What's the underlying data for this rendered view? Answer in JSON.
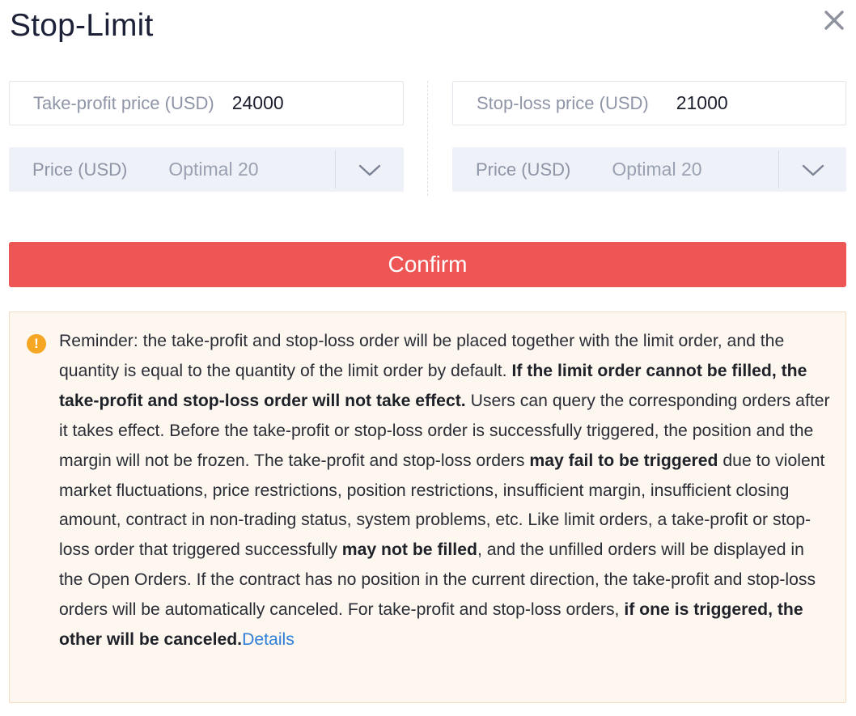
{
  "dialog": {
    "title": "Stop-Limit",
    "close_icon": "close-icon"
  },
  "take_profit": {
    "trigger_label": "Take-profit price (USD)",
    "trigger_value": "24000",
    "price_label": "Price (USD)",
    "price_option": "Optimal 20",
    "dropdown_icon": "chevron-down-icon"
  },
  "stop_loss": {
    "trigger_label": "Stop-loss price (USD)",
    "trigger_value": "21000",
    "price_label": "Price (USD)",
    "price_option": "Optimal 20",
    "dropdown_icon": "chevron-down-icon"
  },
  "confirm_label": "Confirm",
  "notice": {
    "icon": "warning-icon",
    "icon_glyph": "!",
    "p1": "Reminder: the take-profit and stop-loss order will be placed together with the limit order, and the quantity is equal to the quantity of the limit order by default. ",
    "b1": "If the limit order cannot be filled, the take-profit and stop-loss order will not take effect.",
    "p2": " Users can query the corresponding orders after it takes effect. Before the take-profit or stop-loss order is successfully triggered, the position and the margin will not be frozen. The take-profit and stop-loss orders ",
    "b2": "may fail to be triggered",
    "p3": " due to violent market fluctuations, price restrictions, position restrictions, insufficient margin, insufficient closing amount, contract in non-trading status, system problems, etc. Like limit orders, a take-profit or stop-loss order that triggered successfully ",
    "b3": "may not be filled",
    "p4": ", and the unfilled orders will be displayed in the Open Orders. If the contract has no position in the current direction, the take-profit and stop-loss orders will be automatically canceled. For take-profit and stop-loss orders, ",
    "b4": "if one is triggered, the other will be canceled.",
    "link": "Details"
  },
  "colors": {
    "confirm_bg": "#ee5656",
    "link": "#2f7fd8",
    "warning": "#f5a623",
    "notice_bg": "#fdf7f0"
  }
}
